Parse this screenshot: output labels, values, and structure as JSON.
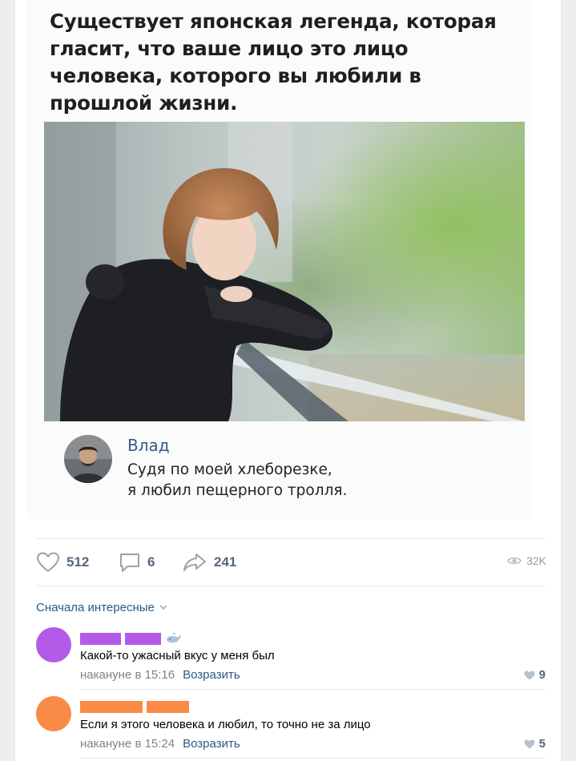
{
  "meme": {
    "caption": "Существует японская легенда, которая гласит, что ваше лицо это лицо человека, которого вы любили в прошлой жизни.",
    "quote": {
      "author": "Влад",
      "text_line1": "Судя по моей хлеборезке,",
      "text_line2": "я любил пещерного тролля."
    }
  },
  "actions": {
    "likes": "512",
    "comments": "6",
    "shares": "241",
    "views": "32K"
  },
  "comments_section": {
    "sort_label": "Сначала интересные",
    "items": [
      {
        "avatar_color": "#b35ae8",
        "name_color": "#b35ae8",
        "text": "Какой-то ужасный вкус у меня был",
        "time": "накануне в 15:16",
        "reply_label": "Возразить",
        "likes": "9",
        "has_badge": true
      },
      {
        "avatar_color": "#fa8a48",
        "name_color": "#fa8a48",
        "text": "Если я этого человека и любил, то точно не за лицо",
        "time": "накануне в 15:24",
        "reply_label": "Возразить",
        "likes": "5",
        "has_badge": false
      }
    ]
  },
  "colors": {
    "link": "#2a5885",
    "muted": "#828282",
    "icon": "#99a2ad"
  }
}
